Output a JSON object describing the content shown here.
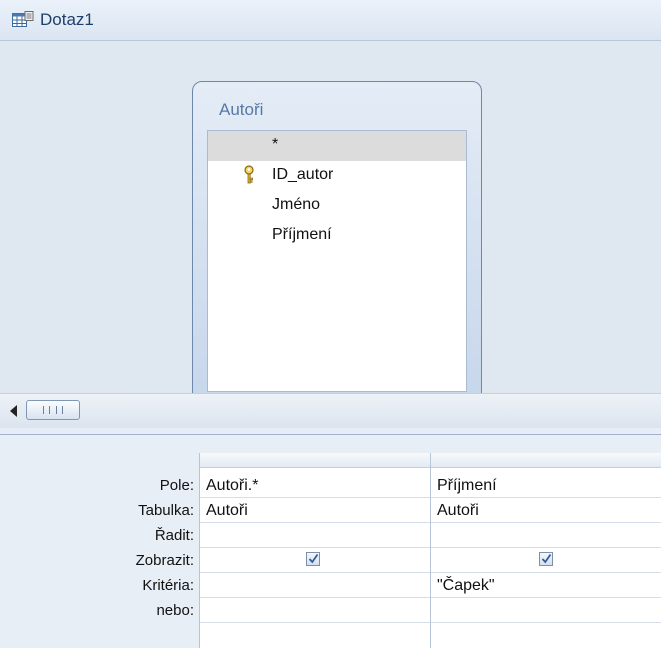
{
  "window": {
    "title": "Dotaz1",
    "icon": "query-icon"
  },
  "table": {
    "name": "Autoři",
    "fields": [
      {
        "label": "*",
        "selected": true,
        "key": false
      },
      {
        "label": "ID_autor",
        "selected": false,
        "key": true
      },
      {
        "label": "Jméno",
        "selected": false,
        "key": false
      },
      {
        "label": "Příjmení",
        "selected": false,
        "key": false
      }
    ]
  },
  "grid": {
    "row_labels": [
      "Pole:",
      "Tabulka:",
      "Řadit:",
      "Zobrazit:",
      "Kritéria:",
      "nebo:"
    ],
    "columns": [
      {
        "pole": "Autoři.*",
        "tabulka": "Autoři",
        "radit": "",
        "zobrazit": true,
        "kriteria": "",
        "nebo": ""
      },
      {
        "pole": "Příjmení",
        "tabulka": "Autoři",
        "radit": "",
        "zobrazit": true,
        "kriteria": "\"Čapek\"",
        "nebo": ""
      }
    ]
  },
  "colors": {
    "accent": "#567aa6",
    "frame": "#6d88ab"
  }
}
